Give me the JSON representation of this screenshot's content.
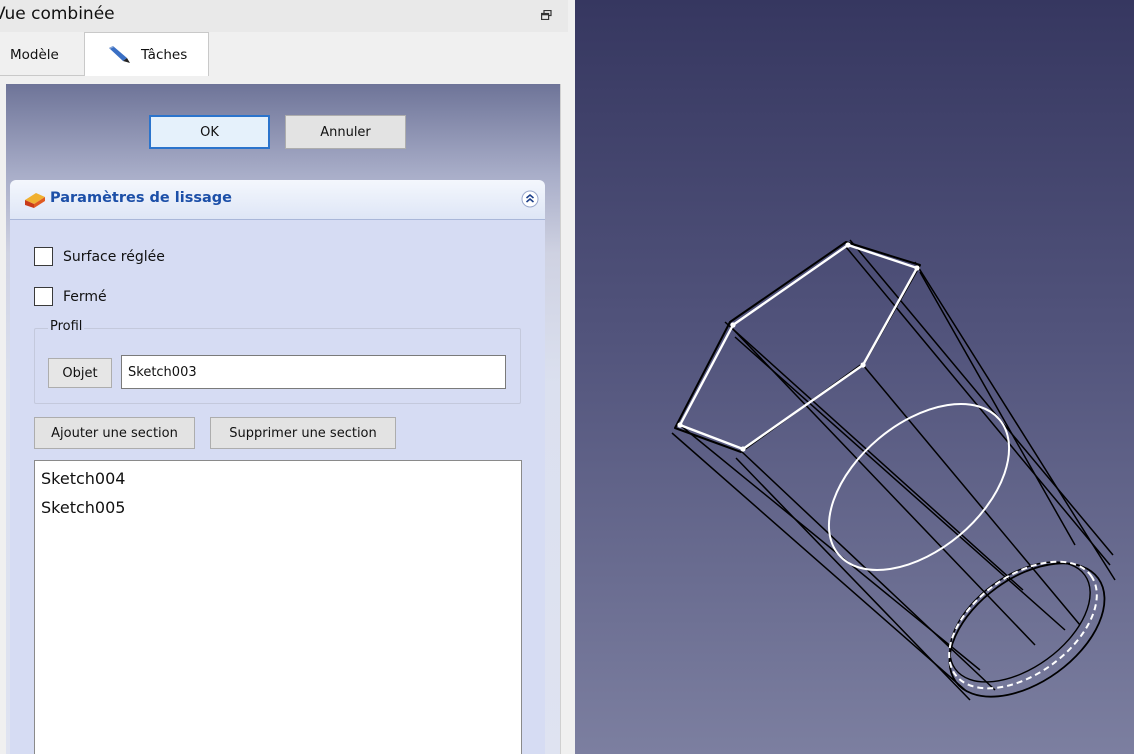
{
  "window": {
    "title": "Vue combinée",
    "restore_icon": "restore-icon"
  },
  "tabs": [
    {
      "label": "Modèle"
    },
    {
      "label": "Tâches",
      "icon": "pencil-icon"
    }
  ],
  "dialog": {
    "ok_label": "OK",
    "cancel_label": "Annuler"
  },
  "loft": {
    "title": "Paramètres de lissage",
    "ruled_surface_label": "Surface réglée",
    "ruled_surface_checked": false,
    "closed_label": "Fermé",
    "closed_checked": false,
    "profile_group_label": "Profil",
    "object_button_label": "Objet",
    "profile_value": "Sketch003",
    "add_section_label": "Ajouter une section",
    "remove_section_label": "Supprimer une section",
    "sections": [
      "Sketch004",
      "Sketch005"
    ]
  },
  "colors": {
    "title_blue": "#1c4fa8",
    "ok_border": "#2b74cc",
    "viewport_top": "#363760",
    "viewport_bottom": "#7c7fa0"
  }
}
